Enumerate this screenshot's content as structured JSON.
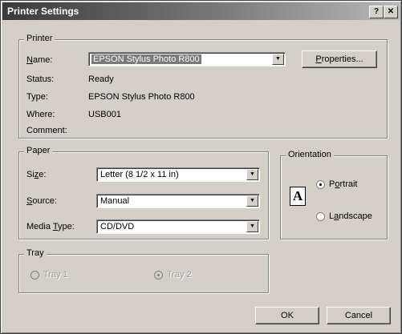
{
  "window": {
    "title": "Printer Settings",
    "help_label": "?",
    "close_label": "✕"
  },
  "printer": {
    "group_label": "Printer",
    "name_label": "Name:",
    "name_value": "EPSON Stylus Photo R800",
    "properties_label": "Properties...",
    "status_label": "Status:",
    "status_value": "Ready",
    "type_label": "Type:",
    "type_value": "EPSON Stylus Photo R800",
    "where_label": "Where:",
    "where_value": "USB001",
    "comment_label": "Comment:",
    "comment_value": ""
  },
  "paper": {
    "group_label": "Paper",
    "size_label": "Size:",
    "size_value": "Letter (8 1/2 x 11 in)",
    "source_label": "Source:",
    "source_value": "Manual",
    "media_label": "Media Type:",
    "media_value": "CD/DVD"
  },
  "orientation": {
    "group_label": "Orientation",
    "icon_letter": "A",
    "portrait_label": "Portrait",
    "landscape_label": "Landscape",
    "selected": "Portrait"
  },
  "tray": {
    "group_label": "Tray",
    "tray1_label": "Tray 1",
    "tray2_label": "Tray 2",
    "selected": "Tray 2"
  },
  "buttons": {
    "ok_label": "OK",
    "cancel_label": "Cancel"
  }
}
